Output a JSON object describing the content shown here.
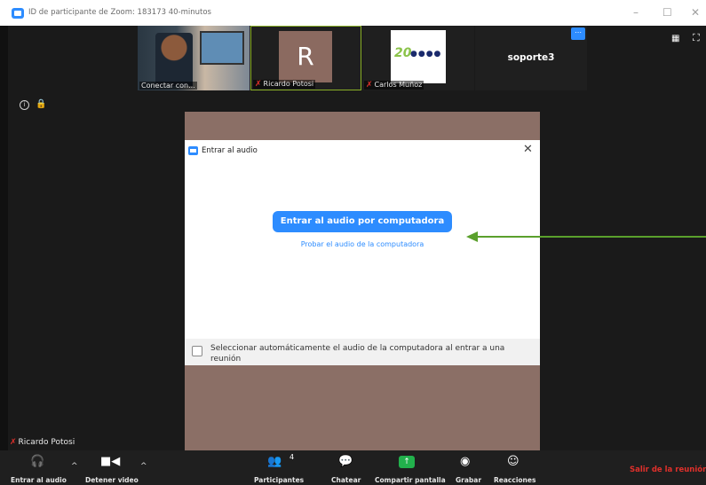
{
  "window": {
    "title": "ID de participante de Zoom: 183173   40-minutos",
    "minimize": "–",
    "maximize": "☐",
    "close": "✕"
  },
  "thumbnails": [
    {
      "label": "Conectar con...",
      "muted": false
    },
    {
      "initial": "R",
      "label": "Ricardo Potosi",
      "muted": true
    },
    {
      "logo_text": "20",
      "logo_dots": "●●●●",
      "label": "Carlos Muñoz",
      "muted": true
    },
    {
      "name": "soporte3",
      "more_icon": "⋯"
    }
  ],
  "top_right": {
    "grid_icon": "▦",
    "fullscreen_icon": "⛶"
  },
  "dialog": {
    "title": "Entrar al audio",
    "close": "✕",
    "join_button": "Entrar al audio por computadora",
    "test_link": "Probar el audio de la computadora",
    "auto_join_text": "Seleccionar automáticamente el audio de la computadora al entrar a una reunión",
    "auto_join_checked": false
  },
  "speaker": {
    "name": "Ricardo Potosi"
  },
  "toolbar": {
    "audio_label": "Entrar al audio",
    "video_label": "Detener video",
    "participants_label": "Participantes",
    "participants_count": "4",
    "chat_label": "Chatear",
    "share_label": "Compartir pantalla",
    "record_label": "Grabar",
    "reactions_label": "Reacciones",
    "leave_label": "Salir de la reunión"
  },
  "colors": {
    "accent": "#2d8cff",
    "share": "#22b14c",
    "leave": "#e0302b",
    "annotation_arrow": "#5aa02c"
  }
}
